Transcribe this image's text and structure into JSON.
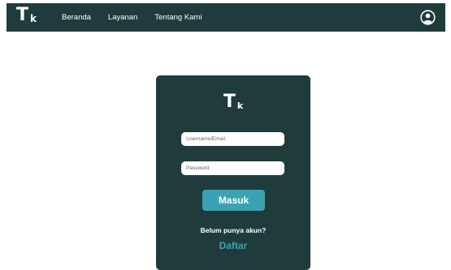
{
  "navbar": {
    "logo_big": "T",
    "logo_small": "k",
    "links": [
      "Beranda",
      "Layanan",
      "Tentang Kami"
    ],
    "profile_icon": "user-circle-icon"
  },
  "login": {
    "logo_big": "T",
    "logo_small": "k",
    "username_placeholder": "Username/Email",
    "password_placeholder": "Password",
    "submit_label": "Masuk",
    "prompt": "Belum punya akun?",
    "register_label": "Daftar"
  },
  "colors": {
    "primary_dark": "#1f3b3b",
    "accent": "#3aa3b3",
    "background": "#ffffff"
  }
}
